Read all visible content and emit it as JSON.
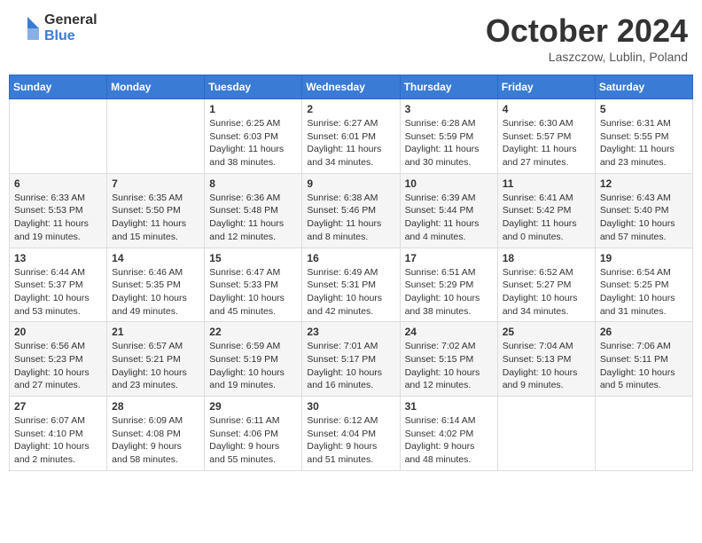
{
  "logo": {
    "general": "General",
    "blue": "Blue"
  },
  "title": "October 2024",
  "location": "Laszczow, Lublin, Poland",
  "weekdays": [
    "Sunday",
    "Monday",
    "Tuesday",
    "Wednesday",
    "Thursday",
    "Friday",
    "Saturday"
  ],
  "weeks": [
    [
      {
        "day": "",
        "info": ""
      },
      {
        "day": "",
        "info": ""
      },
      {
        "day": "1",
        "info": "Sunrise: 6:25 AM\nSunset: 6:03 PM\nDaylight: 11 hours and 38 minutes."
      },
      {
        "day": "2",
        "info": "Sunrise: 6:27 AM\nSunset: 6:01 PM\nDaylight: 11 hours and 34 minutes."
      },
      {
        "day": "3",
        "info": "Sunrise: 6:28 AM\nSunset: 5:59 PM\nDaylight: 11 hours and 30 minutes."
      },
      {
        "day": "4",
        "info": "Sunrise: 6:30 AM\nSunset: 5:57 PM\nDaylight: 11 hours and 27 minutes."
      },
      {
        "day": "5",
        "info": "Sunrise: 6:31 AM\nSunset: 5:55 PM\nDaylight: 11 hours and 23 minutes."
      }
    ],
    [
      {
        "day": "6",
        "info": "Sunrise: 6:33 AM\nSunset: 5:53 PM\nDaylight: 11 hours and 19 minutes."
      },
      {
        "day": "7",
        "info": "Sunrise: 6:35 AM\nSunset: 5:50 PM\nDaylight: 11 hours and 15 minutes."
      },
      {
        "day": "8",
        "info": "Sunrise: 6:36 AM\nSunset: 5:48 PM\nDaylight: 11 hours and 12 minutes."
      },
      {
        "day": "9",
        "info": "Sunrise: 6:38 AM\nSunset: 5:46 PM\nDaylight: 11 hours and 8 minutes."
      },
      {
        "day": "10",
        "info": "Sunrise: 6:39 AM\nSunset: 5:44 PM\nDaylight: 11 hours and 4 minutes."
      },
      {
        "day": "11",
        "info": "Sunrise: 6:41 AM\nSunset: 5:42 PM\nDaylight: 11 hours and 0 minutes."
      },
      {
        "day": "12",
        "info": "Sunrise: 6:43 AM\nSunset: 5:40 PM\nDaylight: 10 hours and 57 minutes."
      }
    ],
    [
      {
        "day": "13",
        "info": "Sunrise: 6:44 AM\nSunset: 5:37 PM\nDaylight: 10 hours and 53 minutes."
      },
      {
        "day": "14",
        "info": "Sunrise: 6:46 AM\nSunset: 5:35 PM\nDaylight: 10 hours and 49 minutes."
      },
      {
        "day": "15",
        "info": "Sunrise: 6:47 AM\nSunset: 5:33 PM\nDaylight: 10 hours and 45 minutes."
      },
      {
        "day": "16",
        "info": "Sunrise: 6:49 AM\nSunset: 5:31 PM\nDaylight: 10 hours and 42 minutes."
      },
      {
        "day": "17",
        "info": "Sunrise: 6:51 AM\nSunset: 5:29 PM\nDaylight: 10 hours and 38 minutes."
      },
      {
        "day": "18",
        "info": "Sunrise: 6:52 AM\nSunset: 5:27 PM\nDaylight: 10 hours and 34 minutes."
      },
      {
        "day": "19",
        "info": "Sunrise: 6:54 AM\nSunset: 5:25 PM\nDaylight: 10 hours and 31 minutes."
      }
    ],
    [
      {
        "day": "20",
        "info": "Sunrise: 6:56 AM\nSunset: 5:23 PM\nDaylight: 10 hours and 27 minutes."
      },
      {
        "day": "21",
        "info": "Sunrise: 6:57 AM\nSunset: 5:21 PM\nDaylight: 10 hours and 23 minutes."
      },
      {
        "day": "22",
        "info": "Sunrise: 6:59 AM\nSunset: 5:19 PM\nDaylight: 10 hours and 19 minutes."
      },
      {
        "day": "23",
        "info": "Sunrise: 7:01 AM\nSunset: 5:17 PM\nDaylight: 10 hours and 16 minutes."
      },
      {
        "day": "24",
        "info": "Sunrise: 7:02 AM\nSunset: 5:15 PM\nDaylight: 10 hours and 12 minutes."
      },
      {
        "day": "25",
        "info": "Sunrise: 7:04 AM\nSunset: 5:13 PM\nDaylight: 10 hours and 9 minutes."
      },
      {
        "day": "26",
        "info": "Sunrise: 7:06 AM\nSunset: 5:11 PM\nDaylight: 10 hours and 5 minutes."
      }
    ],
    [
      {
        "day": "27",
        "info": "Sunrise: 6:07 AM\nSunset: 4:10 PM\nDaylight: 10 hours and 2 minutes."
      },
      {
        "day": "28",
        "info": "Sunrise: 6:09 AM\nSunset: 4:08 PM\nDaylight: 9 hours and 58 minutes."
      },
      {
        "day": "29",
        "info": "Sunrise: 6:11 AM\nSunset: 4:06 PM\nDaylight: 9 hours and 55 minutes."
      },
      {
        "day": "30",
        "info": "Sunrise: 6:12 AM\nSunset: 4:04 PM\nDaylight: 9 hours and 51 minutes."
      },
      {
        "day": "31",
        "info": "Sunrise: 6:14 AM\nSunset: 4:02 PM\nDaylight: 9 hours and 48 minutes."
      },
      {
        "day": "",
        "info": ""
      },
      {
        "day": "",
        "info": ""
      }
    ]
  ]
}
